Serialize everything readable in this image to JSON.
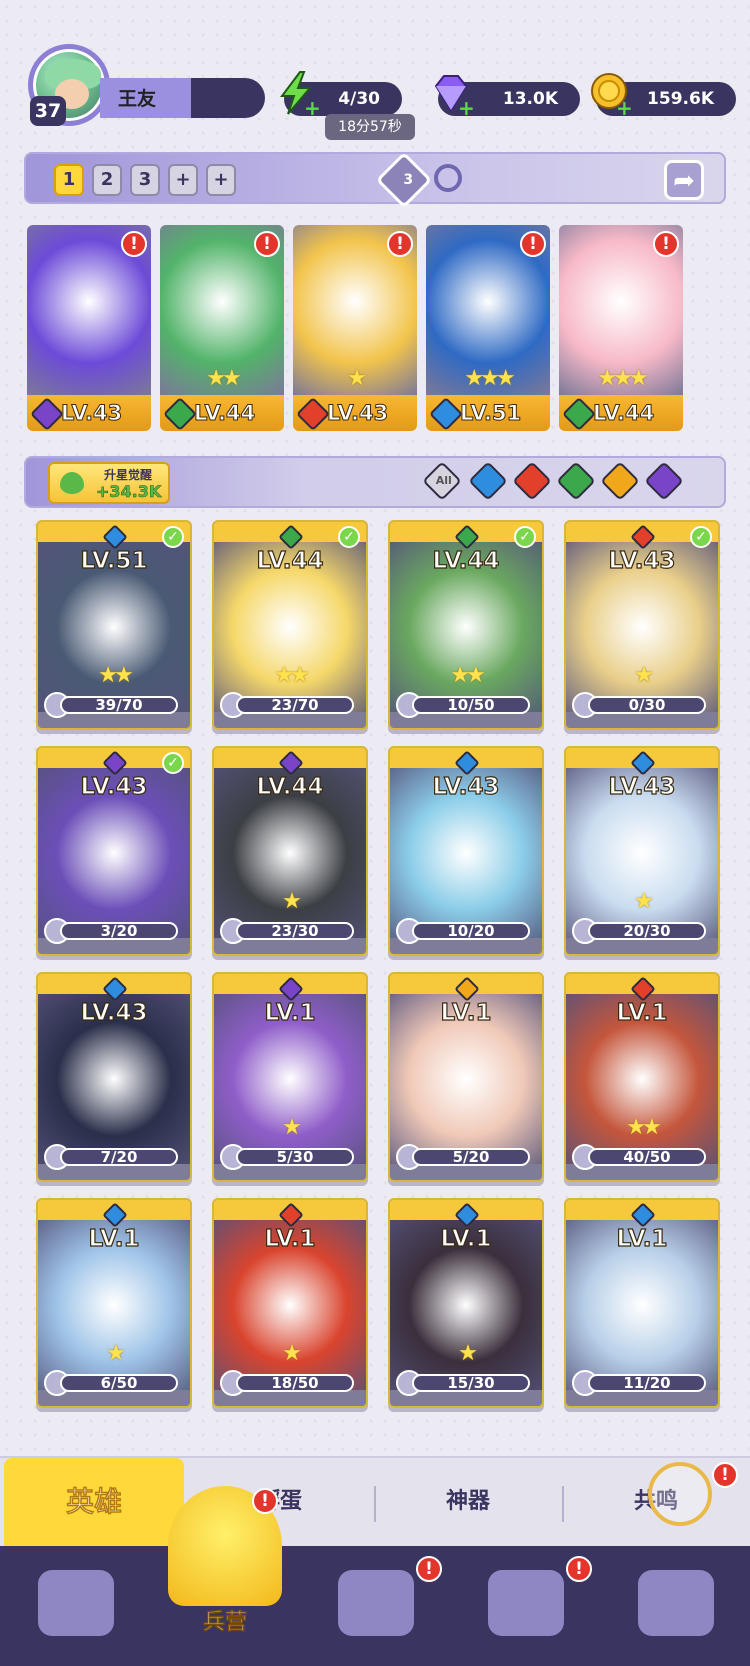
{
  "player": {
    "level": "37",
    "name": "王友"
  },
  "resources": {
    "energy": {
      "value": "4/30",
      "timer": "18分57秒",
      "icon": "lightning-icon"
    },
    "gems": {
      "value": "13.0K",
      "icon": "gem-icon"
    },
    "gold": {
      "value": "159.6K",
      "icon": "coin-icon"
    }
  },
  "team": {
    "tabs": [
      "1",
      "2",
      "3",
      "+",
      "+"
    ],
    "active_tab": "1",
    "gem_count": "3",
    "members": [
      {
        "level": "LV.43",
        "element": "dark",
        "stars": "",
        "alert": "!",
        "color": "#6c4bd8"
      },
      {
        "level": "LV.44",
        "element": "nature",
        "stars": "★★",
        "alert": "!",
        "color": "#52b36a"
      },
      {
        "level": "LV.43",
        "element": "fire",
        "stars": "★",
        "alert": "!",
        "color": "#f2c44c"
      },
      {
        "level": "LV.51",
        "element": "water",
        "stars": "★★★",
        "alert": "!",
        "color": "#2f6ac4"
      },
      {
        "level": "LV.44",
        "element": "nature",
        "stars": "★★★",
        "alert": "!",
        "color": "#f7b9c8"
      }
    ]
  },
  "awaken": {
    "label": "升星觉醒",
    "value": "+34.3K"
  },
  "filters": {
    "all_label": "All",
    "elements": [
      "water",
      "fire",
      "nature",
      "light",
      "dark"
    ]
  },
  "element_colors": {
    "water": "#2f8de0",
    "fire": "#e2402b",
    "nature": "#3ba94b",
    "light": "#f0a81a",
    "dark": "#7a44c8"
  },
  "heroes": [
    {
      "level": "LV.51",
      "element": "water",
      "progress": "39/70",
      "stars": "★★",
      "check": true,
      "color": "#4a5a74"
    },
    {
      "level": "LV.44",
      "element": "nature",
      "progress": "23/70",
      "stars": "★★",
      "check": true,
      "color": "#f5d86a"
    },
    {
      "level": "LV.44",
      "element": "nature",
      "progress": "10/50",
      "stars": "★★",
      "check": true,
      "color": "#6aa860"
    },
    {
      "level": "LV.43",
      "element": "fire",
      "progress": "0/30",
      "stars": "★",
      "check": true,
      "color": "#e9cf8a"
    },
    {
      "level": "LV.43",
      "element": "dark",
      "progress": "3/20",
      "stars": "",
      "check": true,
      "color": "#6b4fb8"
    },
    {
      "level": "LV.44",
      "element": "dark",
      "progress": "23/30",
      "stars": "★",
      "check": false,
      "color": "#3c3f44"
    },
    {
      "level": "LV.43",
      "element": "water",
      "progress": "10/20",
      "stars": "",
      "check": false,
      "color": "#8bcde8"
    },
    {
      "level": "LV.43",
      "element": "water",
      "progress": "20/30",
      "stars": "★",
      "check": false,
      "color": "#c9dcef"
    },
    {
      "level": "LV.43",
      "element": "water",
      "progress": "7/20",
      "stars": "",
      "check": false,
      "color": "#2a2f4a"
    },
    {
      "level": "LV.1",
      "element": "dark",
      "progress": "5/30",
      "stars": "★",
      "check": false,
      "color": "#8f5ec9"
    },
    {
      "level": "LV.1",
      "element": "light",
      "progress": "5/20",
      "stars": "",
      "check": false,
      "color": "#f0c9b8"
    },
    {
      "level": "LV.1",
      "element": "fire",
      "progress": "40/50",
      "stars": "★★",
      "check": false,
      "color": "#c4563c"
    },
    {
      "level": "LV.1",
      "element": "water",
      "progress": "6/50",
      "stars": "★",
      "check": false,
      "color": "#9fc4e8"
    },
    {
      "level": "LV.1",
      "element": "fire",
      "progress": "18/50",
      "stars": "★",
      "check": false,
      "color": "#d9442e"
    },
    {
      "level": "LV.1",
      "element": "water",
      "progress": "15/30",
      "stars": "★",
      "check": false,
      "color": "#3b2f3c"
    },
    {
      "level": "LV.1",
      "element": "water",
      "progress": "11/20",
      "stars": "",
      "check": false,
      "color": "#b7cfe8"
    }
  ],
  "subtabs": {
    "heroes": "英雄",
    "hatch": "孵蛋",
    "artifacts": "神器",
    "resonance": "共鸣",
    "resonance_alert": "!"
  },
  "bottom_nav": {
    "items": [
      {
        "icon": "cards-icon",
        "label": "",
        "alert": ""
      },
      {
        "icon": "barracks-icon",
        "label": "兵营",
        "alert": "!"
      },
      {
        "icon": "map-icon",
        "label": "",
        "alert": "!"
      },
      {
        "icon": "castle-icon",
        "label": "",
        "alert": "!"
      },
      {
        "icon": "mushroom-icon",
        "label": "",
        "alert": ""
      }
    ]
  }
}
